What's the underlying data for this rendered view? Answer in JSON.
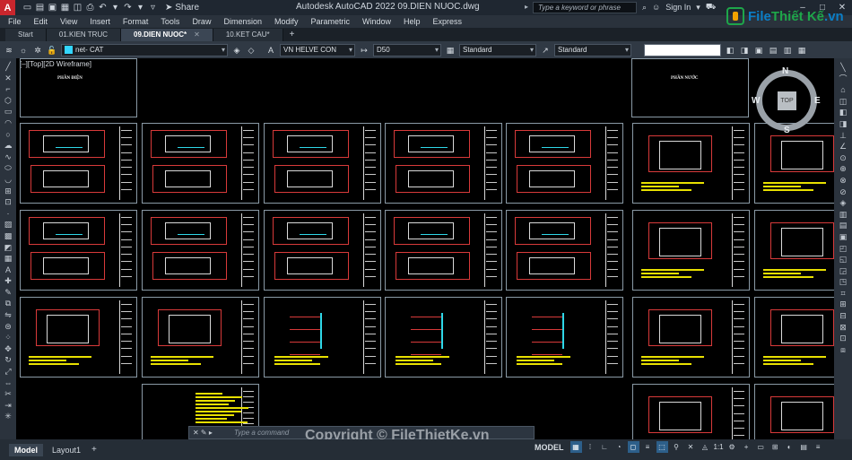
{
  "titlebar": {
    "logo": "A",
    "share": "Share",
    "title": "Autodesk AutoCAD 2022   09.DIEN NUOC.dwg",
    "search_placeholder": "Type a keyword or phrase",
    "sign_in": "Sign In"
  },
  "menu": [
    "File",
    "Edit",
    "View",
    "Insert",
    "Format",
    "Tools",
    "Draw",
    "Dimension",
    "Modify",
    "Parametric",
    "Window",
    "Help",
    "Express"
  ],
  "tabs": [
    {
      "label": "Start",
      "active": false
    },
    {
      "label": "01.KIEN TRUC",
      "active": false
    },
    {
      "label": "09.DIEN NUOC*",
      "active": true
    },
    {
      "label": "10.KET CAU*",
      "active": false
    }
  ],
  "toolbar": {
    "layer": "net- CAT",
    "text_style": "VN HELVE CON",
    "dim_style": "D50",
    "table_style": "Standard",
    "multileader_style": "Standard"
  },
  "viewport": {
    "label": "[–][Top][2D Wireframe]",
    "sheet_title_left": "PHẦN ĐIỆN",
    "sheet_title_right": "PHẦN NƯỚC"
  },
  "viewcube": {
    "n": "N",
    "s": "S",
    "e": "E",
    "w": "W",
    "face": "TOP"
  },
  "command": {
    "placeholder": "Type a command"
  },
  "layouts": [
    {
      "label": "Model",
      "active": true
    },
    {
      "label": "Layout1",
      "active": false
    }
  ],
  "status": {
    "model": "MODEL",
    "scale": "1:1"
  },
  "watermark": "Copyright © FileThietKe.vn",
  "brand": {
    "part1": "File",
    "part2": "Thiết Kế",
    "part3": ".vn"
  }
}
